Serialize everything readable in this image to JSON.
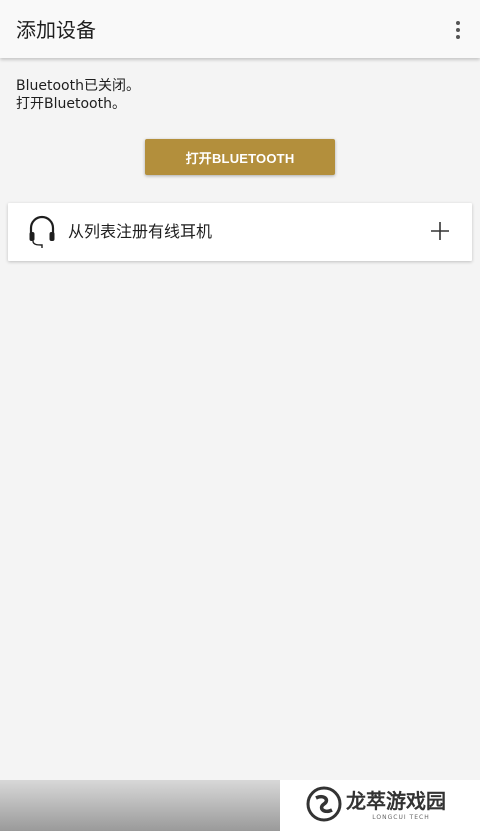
{
  "app_bar": {
    "title": "添加设备",
    "overflow_icon": "more-vert-icon"
  },
  "status": {
    "line1": "Bluetooth已关闭。",
    "line2": "打开Bluetooth。"
  },
  "enable_button": {
    "label": "打开BLUETOOTH",
    "color": "#b38f3c"
  },
  "wired_card": {
    "icon": "headphones-icon",
    "label": "从列表注册有线耳机",
    "action_icon": "plus-icon"
  },
  "watermark": {
    "title": "龙萃游戏园",
    "subtitle": "LONGCUI TECH"
  }
}
